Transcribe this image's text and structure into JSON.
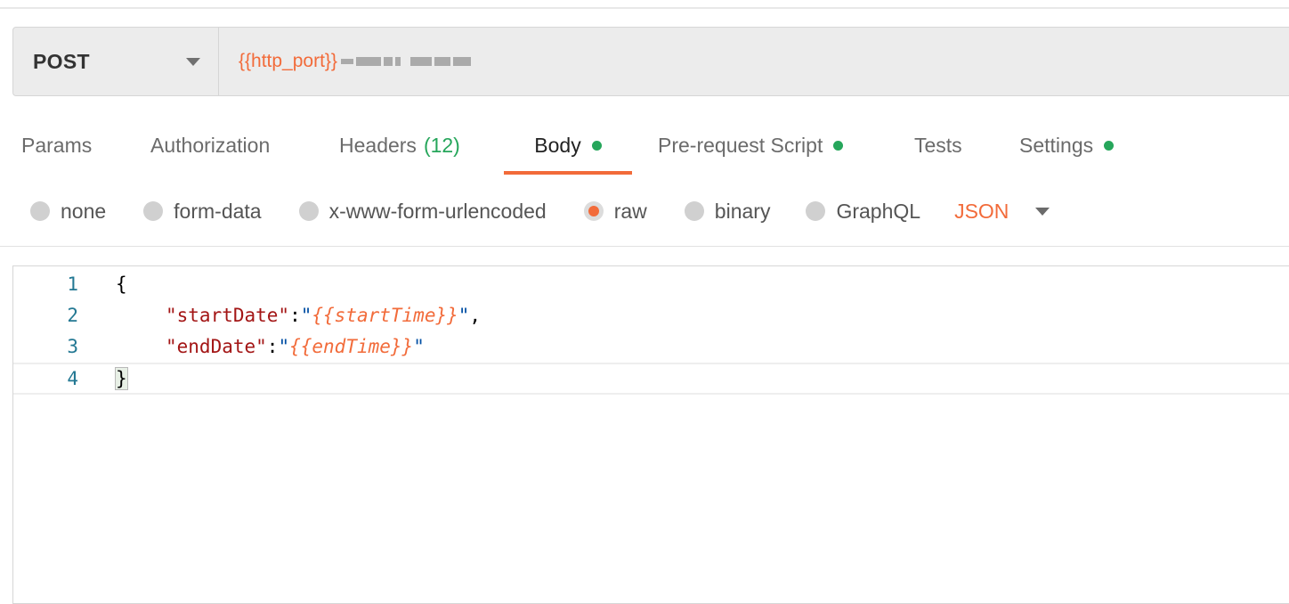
{
  "request": {
    "method": "POST",
    "url_variable": "{{http_port}}"
  },
  "tabs": [
    {
      "label": "Params"
    },
    {
      "label": "Authorization"
    },
    {
      "label": "Headers",
      "count": "(12)"
    },
    {
      "label": "Body",
      "active": true,
      "indicator": true
    },
    {
      "label": "Pre-request Script",
      "indicator": true
    },
    {
      "label": "Tests"
    },
    {
      "label": "Settings",
      "indicator": true
    }
  ],
  "body_types": [
    {
      "label": "none"
    },
    {
      "label": "form-data"
    },
    {
      "label": "x-www-form-urlencoded"
    },
    {
      "label": "raw",
      "selected": true
    },
    {
      "label": "binary"
    },
    {
      "label": "GraphQL"
    }
  ],
  "format": "JSON",
  "editor": {
    "line_numbers": [
      "1",
      "2",
      "3",
      "4"
    ],
    "open_brace": "{",
    "close_brace": "}",
    "fields": [
      {
        "key": "\"startDate\"",
        "colon": ":",
        "quote": "\"",
        "value": "{{startTime}}",
        "trail": ","
      },
      {
        "key": "\"endDate\"",
        "colon": ":",
        "quote": "\"",
        "value": "{{endTime}}",
        "trail": ""
      }
    ]
  },
  "colors": {
    "accent": "#f26b3a",
    "indicator_green": "#26a65b",
    "json_key": "#a31515",
    "json_quote": "#0451a5",
    "line_number": "#237893"
  }
}
